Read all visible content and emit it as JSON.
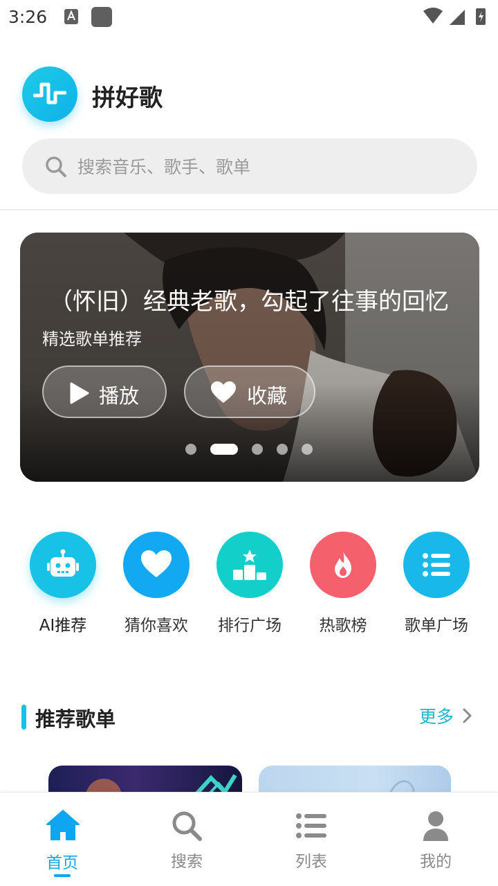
{
  "status_bar": {
    "time": "3:26"
  },
  "header": {
    "app_name": "拼好歌"
  },
  "search": {
    "placeholder": "搜索音乐、歌手、歌单"
  },
  "banner": {
    "title": "（怀旧）经典老歌，勾起了往事的回忆",
    "subtitle": "精选歌单推荐",
    "play_label": "播放",
    "favorite_label": "收藏",
    "page_count": 5,
    "active_page": 2
  },
  "shortcuts": [
    {
      "label": "AI推荐",
      "icon": "robot-icon",
      "color": "#17c2e6"
    },
    {
      "label": "猜你喜欢",
      "icon": "heart-icon",
      "color": "#12a8f2"
    },
    {
      "label": "排行广场",
      "icon": "podium-icon",
      "color": "#12cfc9"
    },
    {
      "label": "热歌榜",
      "icon": "flame-icon",
      "color": "#f5606d"
    },
    {
      "label": "歌单广场",
      "icon": "list-icon",
      "color": "#18b8ea"
    }
  ],
  "section": {
    "title": "推荐歌单",
    "more_label": "更多"
  },
  "bottom_nav": [
    {
      "label": "首页",
      "icon": "home-icon",
      "active": true
    },
    {
      "label": "搜索",
      "icon": "search-icon",
      "active": false
    },
    {
      "label": "列表",
      "icon": "list-icon",
      "active": false
    },
    {
      "label": "我的",
      "icon": "user-icon",
      "active": false
    }
  ],
  "colors": {
    "accent": "#0fa6f1",
    "more_link": "#1fb5c9",
    "section_bar": "#12c3e8"
  }
}
